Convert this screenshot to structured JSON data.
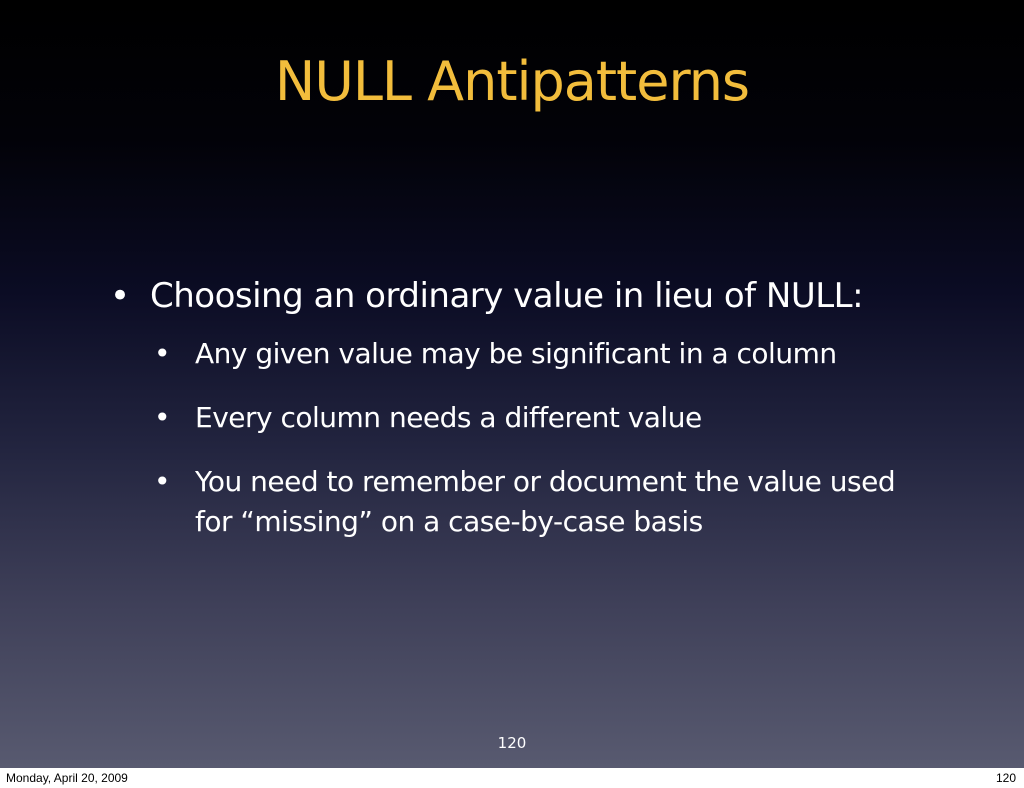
{
  "slide": {
    "title": "NULL Antipatterns",
    "bullet": {
      "text": "Choosing an ordinary value in lieu of NULL:",
      "sub_items": [
        "Any given value may be significant in a column",
        "Every column needs a different value",
        "You need to remember or document the value used for “missing” on a case-by-case basis"
      ]
    },
    "page_number": "120",
    "bullet_glyph": "•",
    "colors": {
      "title": "#f2bd3c",
      "text": "#ffffff",
      "background_top": "#000000",
      "background_bottom": "#585a70"
    }
  },
  "footer": {
    "date": "Monday, April 20, 2009",
    "page": "120"
  }
}
